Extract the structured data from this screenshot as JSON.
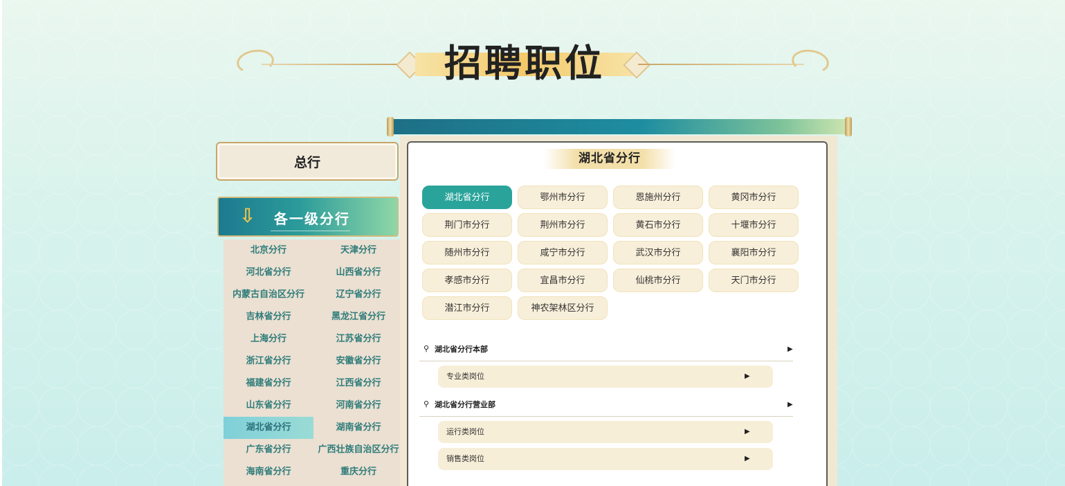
{
  "page_title": "招聘职位",
  "headquarters_label": "总行",
  "branch_header_label": "各一级分行",
  "branches": [
    [
      "北京分行",
      "天津分行"
    ],
    [
      "河北省分行",
      "山西省分行"
    ],
    [
      "内蒙古自治区分行",
      "辽宁省分行"
    ],
    [
      "吉林省分行",
      "黑龙江省分行"
    ],
    [
      "上海分行",
      "江苏省分行"
    ],
    [
      "浙江省分行",
      "安徽省分行"
    ],
    [
      "福建省分行",
      "江西省分行"
    ],
    [
      "山东省分行",
      "河南省分行"
    ],
    [
      "湖北省分行",
      "湖南省分行"
    ],
    [
      "广东省分行",
      "广西壮族自治区分行"
    ],
    [
      "海南省分行",
      "重庆分行"
    ]
  ],
  "active_branch": "湖北省分行",
  "panel_title": "湖北省分行",
  "cities": [
    "湖北省分行",
    "鄂州市分行",
    "恩施州分行",
    "黄冈市分行",
    "荆门市分行",
    "荆州市分行",
    "黄石市分行",
    "十堰市分行",
    "随州市分行",
    "咸宁市分行",
    "武汉市分行",
    "襄阳市分行",
    "孝感市分行",
    "宜昌市分行",
    "仙桃市分行",
    "天门市分行",
    "潜江市分行",
    "神农架林区分行"
  ],
  "active_city": "湖北省分行",
  "departments": [
    {
      "name": "湖北省分行本部",
      "jobs": [
        "专业类岗位"
      ]
    },
    {
      "name": "湖北省分行营业部",
      "jobs": [
        "运行类岗位",
        "销售类岗位"
      ]
    }
  ],
  "icons": {
    "pin": "location-pin-icon",
    "caret": "caret-right-icon",
    "arrow": "down-arrow-icon"
  },
  "colors": {
    "accent_teal": "#2aa49b",
    "branch_text": "#2f7c7a",
    "button_fill": "#f8efda",
    "gold": "#f3c96a"
  }
}
